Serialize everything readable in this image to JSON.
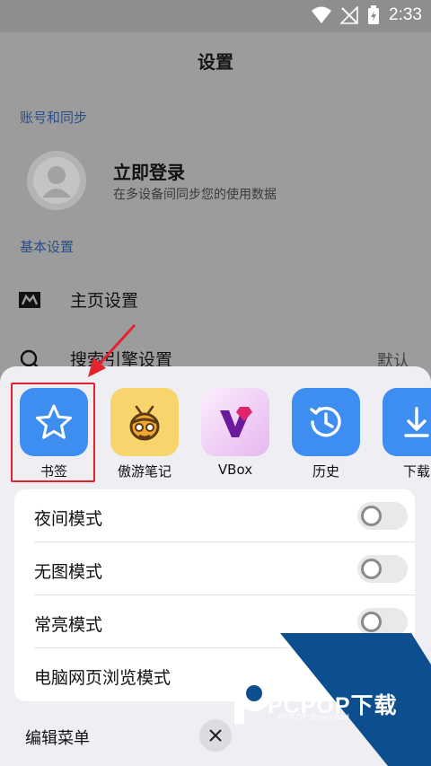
{
  "status": {
    "time": "2:33"
  },
  "page": {
    "title": "设置",
    "account_section": "账号和同步",
    "login_title": "立即登录",
    "login_subtitle": "在多设备间同步您的使用数据",
    "basic_section": "基本设置",
    "rows": [
      {
        "label": "主页设置",
        "icon": "home-logo-icon"
      },
      {
        "label": "搜索引擎设置",
        "icon": "search-icon",
        "value": "默认"
      }
    ]
  },
  "sheet": {
    "apps": [
      {
        "label": "书签",
        "icon": "star-icon",
        "color": "#3e8ef1"
      },
      {
        "label": "傲游笔记",
        "icon": "bee-icon",
        "color": "#f8d46c"
      },
      {
        "label": "VBox",
        "icon": "vbox-icon",
        "color": "#f2d9f5"
      },
      {
        "label": "历史",
        "icon": "history-icon",
        "color": "#3e8ef1"
      },
      {
        "label": "下载",
        "icon": "download-icon",
        "color": "#3e8ef1"
      }
    ],
    "toggles": [
      {
        "label": "夜间模式",
        "on": false
      },
      {
        "label": "无图模式",
        "on": false
      },
      {
        "label": "常亮模式",
        "on": false
      },
      {
        "label": "电脑网页浏览模式",
        "on": false
      }
    ],
    "edit_menu": "编辑菜单"
  },
  "watermark": {
    "text": "PCPOP下载",
    "sub": "PCPOP Download"
  },
  "colors": {
    "accent": "#3e8ef1",
    "highlight": "#e3232d",
    "watermark": "#0d4f8e"
  }
}
